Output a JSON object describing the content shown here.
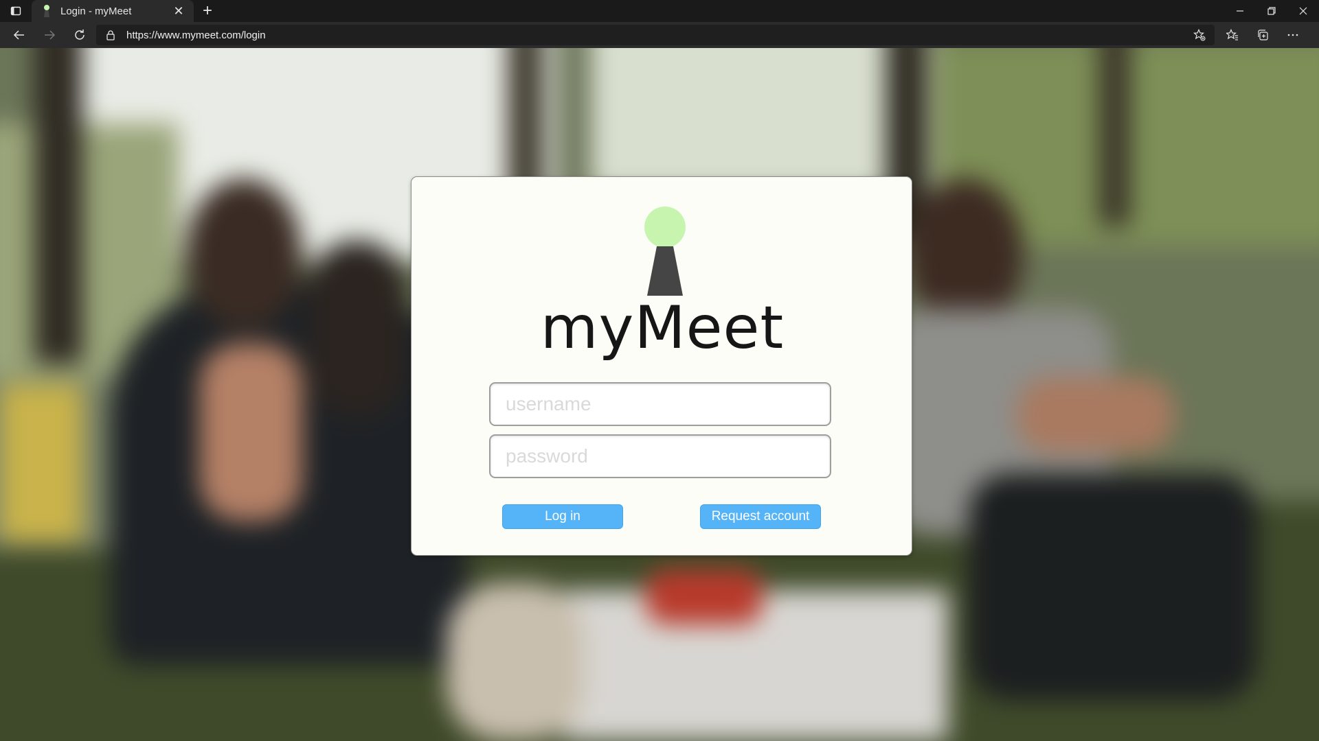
{
  "browser": {
    "tab": {
      "title": "Login - myMeet",
      "close_glyph": "✕"
    },
    "new_tab_glyph": "+",
    "address": {
      "url": "https://www.mymeet.com/login"
    },
    "icons": {
      "tab_actions": "tab-actions-icon",
      "back": "back-arrow-icon",
      "forward": "forward-arrow-icon",
      "reload": "reload-icon",
      "lock": "lock-icon",
      "add_favorite": "add-favorite-icon",
      "favorites": "favorites-icon",
      "collections": "collections-icon",
      "more": "more-icon",
      "minimize": "minimize-icon",
      "restore": "restore-icon",
      "close": "close-window-icon"
    }
  },
  "login": {
    "brand": "myMeet",
    "username_placeholder": "username",
    "password_placeholder": "password",
    "login_button": "Log in",
    "request_button": "Request account"
  },
  "colors": {
    "logo_head": "#c7f5b0",
    "logo_body": "#454545",
    "button": "#54b4f7",
    "card": "#fdfdf8"
  }
}
